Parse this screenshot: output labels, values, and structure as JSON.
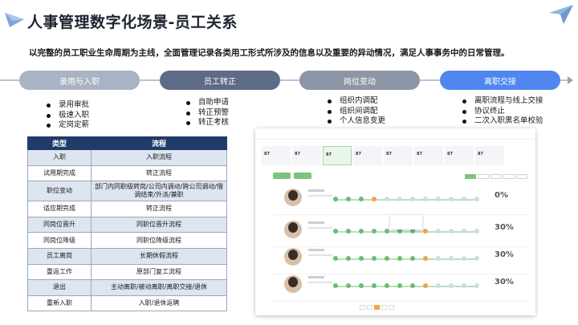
{
  "title": "人事管理数字化场景-员工关系",
  "subtitle": "以完整的员工职业生命周期为主线，全面管理记录各类用工形式所涉及的信息以及重要的异动情况，满足人事事务中的日常管理。",
  "stages": [
    {
      "label": "录用与入职",
      "items": [
        "录用审批",
        "极速入职",
        "定岗定薪"
      ]
    },
    {
      "label": "员工转正",
      "items": [
        "自助申请",
        "转正预警",
        "转正考核"
      ]
    },
    {
      "label": "岗位变动",
      "items": [
        "组织内调配",
        "组织间调配",
        "个人信息变更"
      ]
    },
    {
      "label": "离职交接",
      "items": [
        "离职流程与线上交接",
        "协议终止",
        "二次入职黑名单校验"
      ]
    }
  ],
  "table": {
    "headers": [
      "类型",
      "流程"
    ],
    "rows": [
      [
        "入职",
        "入职流程"
      ],
      [
        "试用期完成",
        "转正流程"
      ],
      [
        "职位变动",
        "部门内同职级转岗/公司内调动/跨公司调动/借 调结束/外派/兼职"
      ],
      [
        "适应期完成",
        "转正流程"
      ],
      [
        "同岗位晋升",
        "同职位晋升流程"
      ],
      [
        "同岗位降级",
        "同职位降级流程"
      ],
      [
        "员工离岗",
        "长期休假流程"
      ],
      [
        "重返工作",
        "原部门复工流程"
      ],
      [
        "退出",
        "主动离职/被动离职/离职交接/退休"
      ],
      [
        "重新入职",
        "入职/退休返聘"
      ]
    ]
  },
  "screenshot": {
    "stats": [
      "87",
      "87",
      "87",
      "87",
      "87",
      "87",
      "87",
      "87"
    ],
    "employees": [
      {
        "percent": "0%",
        "progress": 0.25
      },
      {
        "percent": "30%",
        "progress": 0.55
      },
      {
        "percent": "30%",
        "progress": 0.55
      },
      {
        "percent": "30%",
        "progress": 0.6
      }
    ]
  },
  "colors": {
    "stage_1": "#a9b3c3",
    "stage_2": "#5d6b86",
    "stage_3": "#8d96a6",
    "stage_4": "#4f86f0",
    "table_header": "#1f3b68",
    "table_stripe": "#dde5f0"
  }
}
